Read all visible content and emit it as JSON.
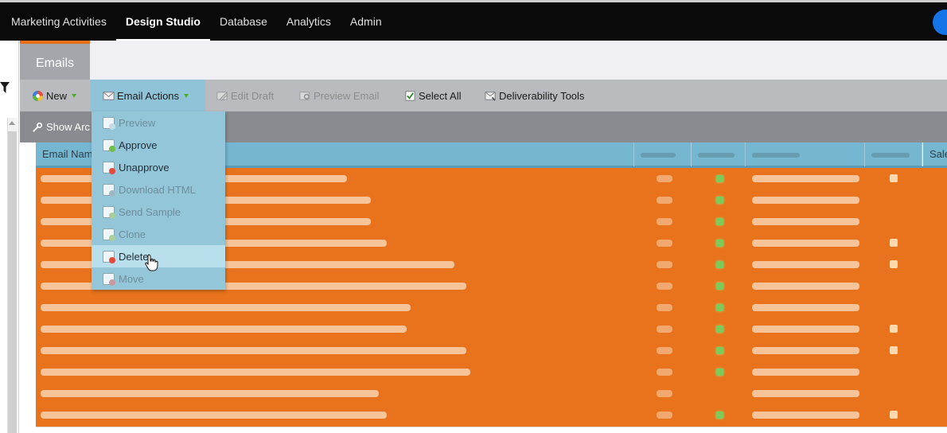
{
  "topnav": {
    "items": [
      "Marketing Activities",
      "Design Studio",
      "Database",
      "Analytics",
      "Admin"
    ],
    "active_index": 1
  },
  "tab": {
    "label": "Emails"
  },
  "toolbar": {
    "new_label": "New",
    "email_actions_label": "Email Actions",
    "edit_draft_label": "Edit Draft",
    "preview_email_label": "Preview Email",
    "select_all_label": "Select All",
    "deliverability_label": "Deliverability Tools"
  },
  "subbar": {
    "show_archive_label": "Show Arc"
  },
  "grid": {
    "email_name_header": "Email Nam",
    "sales_header": "Sale"
  },
  "menu": {
    "items": [
      {
        "label": "Preview",
        "enabled": false,
        "icon": "preview-icon"
      },
      {
        "label": "Approve",
        "enabled": true,
        "icon": "approve-icon"
      },
      {
        "label": "Unapprove",
        "enabled": true,
        "icon": "unapprove-icon"
      },
      {
        "label": "Download HTML",
        "enabled": false,
        "icon": "floppy-disk-icon"
      },
      {
        "label": "Send Sample",
        "enabled": false,
        "icon": "send-sample-icon"
      },
      {
        "label": "Clone",
        "enabled": false,
        "icon": "clone-icon"
      },
      {
        "label": "Delete",
        "enabled": true,
        "icon": "delete-icon",
        "hover": true
      },
      {
        "label": "Move",
        "enabled": false,
        "icon": "move-icon"
      }
    ]
  },
  "colors": {
    "selection_orange": "#e8731c",
    "menu_blue": "#94c6d9",
    "header_blue": "#75b6d1"
  }
}
